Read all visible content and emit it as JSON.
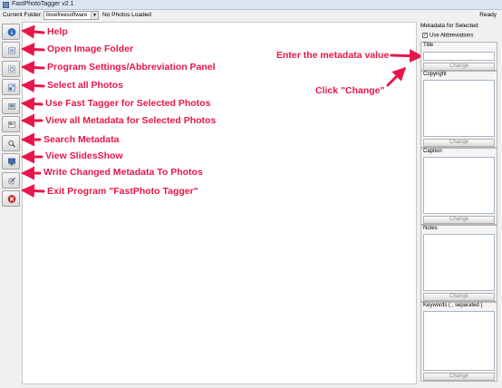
{
  "window": {
    "title": "FastPhotoTagger v2.1"
  },
  "folder_bar": {
    "label": "Current Folder:",
    "folder_value": "ilovefreesoftware",
    "status": "No Photos Loaded",
    "ready": "Ready"
  },
  "toolbar": {
    "buttons": [
      {
        "icon": "help-icon"
      },
      {
        "icon": "open-folder-icon"
      },
      {
        "icon": "settings-icon"
      },
      {
        "icon": "select-all-icon"
      },
      {
        "icon": "fast-tagger-icon"
      },
      {
        "icon": "view-metadata-icon"
      },
      {
        "icon": "search-icon"
      },
      {
        "icon": "slideshow-icon"
      },
      {
        "icon": "write-metadata-icon"
      },
      {
        "icon": "exit-icon"
      }
    ]
  },
  "annotations": {
    "help": "Help",
    "open_folder": "Open Image Folder",
    "settings": "Program Settings/Abbreviation Panel",
    "select_all": "Select all Photos",
    "fast_tagger": "Use Fast Tagger for Selected Photos",
    "view_metadata": "View all Metadata for Selected Photos",
    "search": "Search Metadata",
    "slideshow": "View SlidesShow",
    "write": "Write Changed Metadata To Photos",
    "exit": "Exit Program \"FastPhoto Tagger\"",
    "enter_value": "Enter the metadata value",
    "click_change": "Click \"Change\""
  },
  "metadata_panel": {
    "title": "Metadata for Selected",
    "abbreviations_label": "Use Abbreviations",
    "abbreviations_checked": true,
    "fields": [
      {
        "label": "Title",
        "button": "Change"
      },
      {
        "label": "Copyright",
        "button": "Change"
      },
      {
        "label": "Caption",
        "button": "Change"
      },
      {
        "label": "Notes",
        "button": "Change"
      },
      {
        "label": "Keywords ( , separated )",
        "button": "Change"
      }
    ]
  },
  "colors": {
    "annotation": "#e8164a",
    "titlebar": "#dbe5f1"
  }
}
